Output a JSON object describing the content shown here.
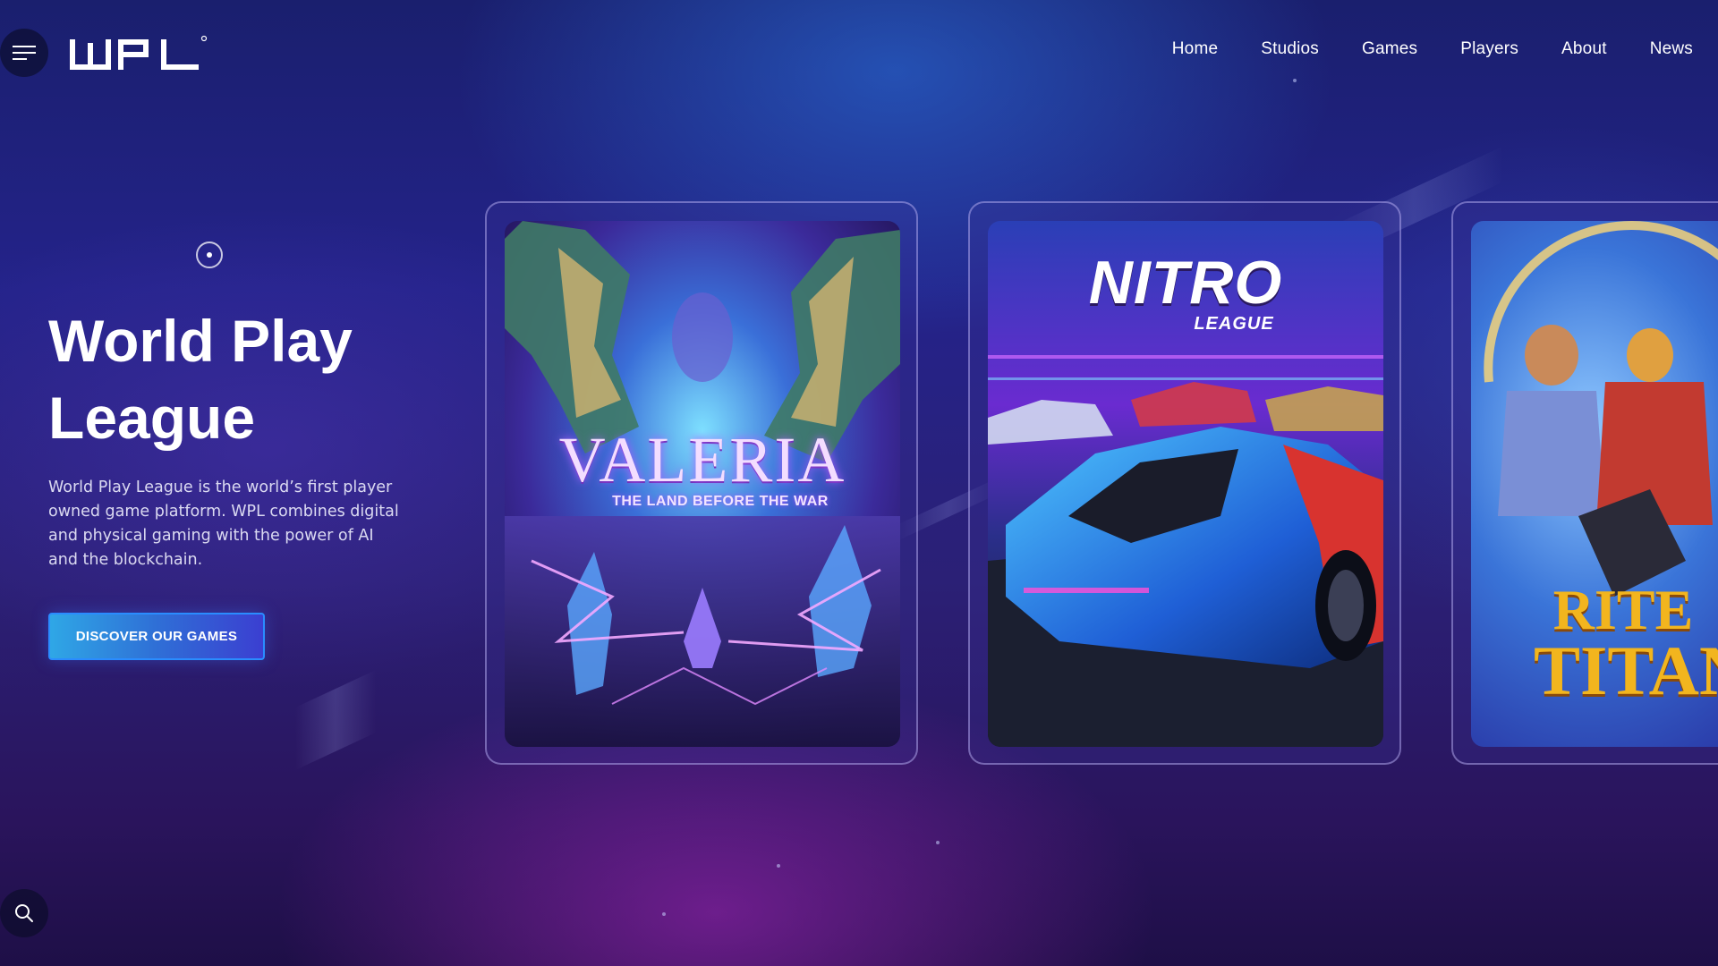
{
  "brand": {
    "logo_text": "WPL",
    "logo_mark": "®"
  },
  "header": {
    "menu_icon": "hamburger-menu-icon",
    "nav": [
      {
        "label": "Home"
      },
      {
        "label": "Studios"
      },
      {
        "label": "Games"
      },
      {
        "label": "Players"
      },
      {
        "label": "About"
      },
      {
        "label": "News"
      }
    ]
  },
  "hero": {
    "scroll_icon": "scroll-indicator-icon",
    "title": "World Play League",
    "description": "World Play League is the world’s first player owned game platform. WPL combines digital and physical gaming with the power of AI and the blockchain.",
    "cta_label": "DISCOVER OUR GAMES",
    "cta_color": "#2f6fd6"
  },
  "games": [
    {
      "title": "VALERIA",
      "subtitle": "THE LAND BEFORE THE WAR",
      "accent": "#e9c7ff"
    },
    {
      "title": "NITRO",
      "subtitle": "LEAGUE",
      "accent": "#ffffff"
    },
    {
      "title": "RITE",
      "subtitle": "TITAN",
      "accent": "#f2b51e"
    }
  ],
  "footer": {
    "search_icon": "search-icon"
  },
  "colors": {
    "background_top": "#1a1f6e",
    "background_bottom": "#1e0f47",
    "card_border": "#c8beff"
  }
}
